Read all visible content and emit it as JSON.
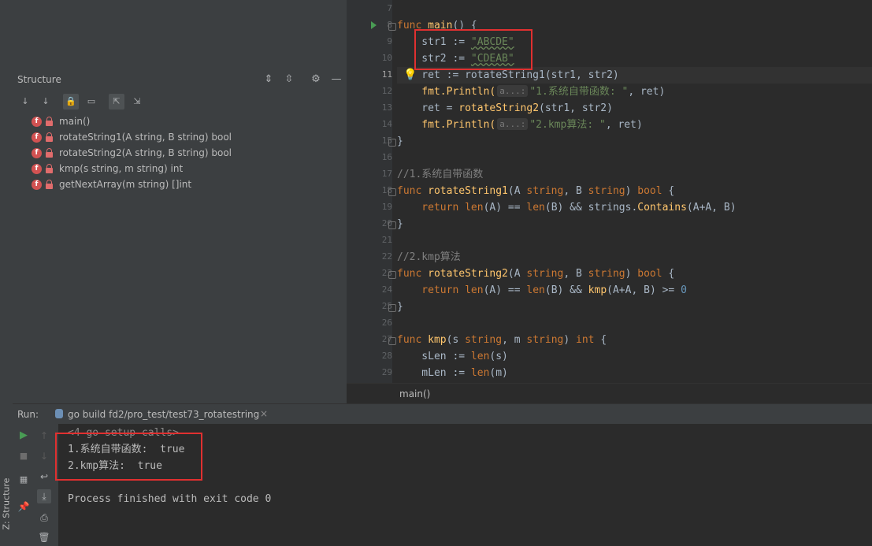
{
  "sidebar_tab": {
    "label": "Z: Structure"
  },
  "structure": {
    "title": "Structure",
    "items": [
      {
        "icon": "f",
        "label": "main()"
      },
      {
        "icon": "f",
        "label": "rotateString1(A string, B string) bool"
      },
      {
        "icon": "f",
        "label": "rotateString2(A string, B string) bool"
      },
      {
        "icon": "f",
        "label": "kmp(s string, m string) int"
      },
      {
        "icon": "f",
        "label": "getNextArray(m string) []int"
      }
    ]
  },
  "editor": {
    "line_numbers": [
      "7",
      "8",
      "9",
      "10",
      "11",
      "12",
      "13",
      "14",
      "15",
      "16",
      "17",
      "18",
      "19",
      "20",
      "21",
      "22",
      "23",
      "24",
      "25",
      "26",
      "27",
      "28",
      "29"
    ],
    "current_line": "11",
    "lines": {
      "l8": {
        "kw": "func",
        "name": "main",
        "rest": "() {"
      },
      "l9": {
        "pre": "    str1 := ",
        "str": "\"ABCDE\""
      },
      "l10": {
        "pre": "    str2 := ",
        "str": "\"CDEAB\""
      },
      "l11": {
        "pre": "    ret := rotateString1",
        "rest": "(str1, str2)"
      },
      "l12": {
        "fn": "    fmt.Println(",
        "hint": "a...:",
        "str": "\"1.系统自带函数: \"",
        "rest": ", ret)"
      },
      "l13": {
        "pre": "    ret = ",
        "fn": "rotateString2",
        "rest": "(str1, str2)"
      },
      "l14": {
        "fn": "    fmt.Println(",
        "hint": "a...:",
        "str": "\"2.kmp算法: \"",
        "rest": ", ret)"
      },
      "l15": {
        "text": "}"
      },
      "l17": {
        "comment": "//1.系统自带函数"
      },
      "l18": {
        "kw": "func",
        "name": "rotateString1",
        "p1": "(A ",
        "t1": "string",
        "p2": ", B ",
        "t2": "string",
        "p3": ") ",
        "t3": "bool",
        "p4": " {"
      },
      "l19": {
        "kw": "    return",
        "b1": " len",
        "a1": "(A) == ",
        "b2": "len",
        "a2": "(B) && ",
        "pkg": "strings.",
        "call": "Contains",
        "a3": "(A+A, B)"
      },
      "l20": {
        "text": "}"
      },
      "l22": {
        "comment": "//2.kmp算法"
      },
      "l23": {
        "kw": "func",
        "name": "rotateString2",
        "p1": "(A ",
        "t1": "string",
        "p2": ", B ",
        "t2": "string",
        "p3": ") ",
        "t3": "bool",
        "p4": " {"
      },
      "l24": {
        "kw": "    return",
        "b1": " len",
        "a1": "(A) == ",
        "b2": "len",
        "a2": "(B) && ",
        "call": "kmp",
        "a3": "(A+A, B) >= ",
        "num": "0"
      },
      "l25": {
        "text": "}"
      },
      "l27": {
        "kw": "func",
        "name": "kmp",
        "p1": "(s ",
        "t1": "string",
        "p2": ", m ",
        "t2": "string",
        "p3": ") ",
        "t3": "int",
        "p4": " {"
      },
      "l28": {
        "pre": "    sLen := ",
        "b1": "len",
        "rest": "(s)"
      },
      "l29": {
        "pre": "    mLen := ",
        "b1": "len",
        "rest": "(m)"
      }
    },
    "breadcrumb": "main()"
  },
  "run": {
    "label": "Run:",
    "tab_label": "go build fd2/pro_test/test73_rotatestring",
    "console": {
      "line0": "<4 go setup calls>",
      "line1": "1.系统自带函数:  true",
      "line2": "2.kmp算法:  true",
      "line3": "Process finished with exit code 0"
    }
  },
  "colors": {
    "highlight_box": "#e03030",
    "keyword": "#cc7832",
    "function": "#ffc66d",
    "string": "#6a8759"
  }
}
